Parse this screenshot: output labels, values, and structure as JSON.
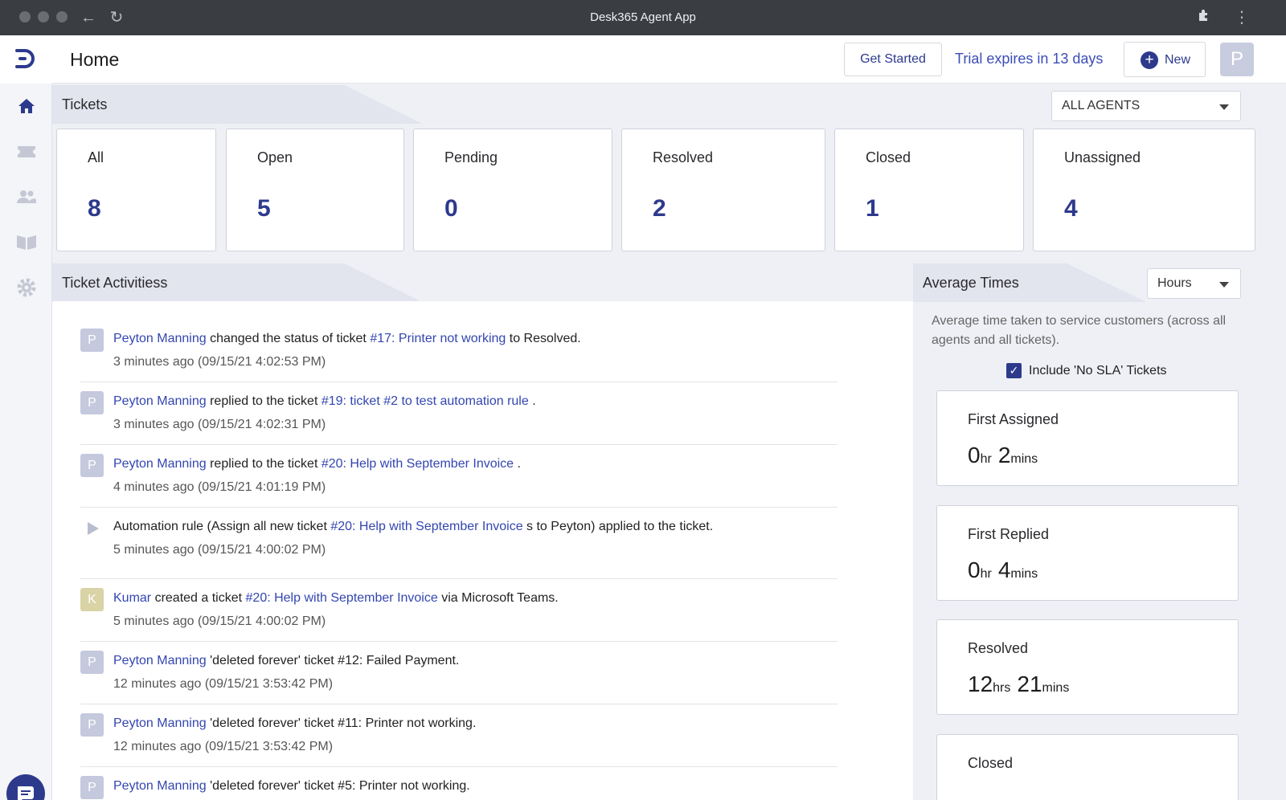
{
  "window": {
    "title": "Desk365 Agent App"
  },
  "header": {
    "title": "Home",
    "get_started": "Get Started",
    "trial": "Trial expires in 13 days",
    "new_label": "New",
    "avatar_initial": "P"
  },
  "nav": {
    "items": [
      {
        "icon": "home-icon"
      },
      {
        "icon": "tickets-icon"
      },
      {
        "icon": "contacts-icon"
      },
      {
        "icon": "knowledge-base-icon"
      },
      {
        "icon": "settings-icon"
      }
    ]
  },
  "tickets": {
    "section_title": "Tickets",
    "agent_filter": "ALL AGENTS",
    "stats": [
      {
        "label": "All",
        "value": "8"
      },
      {
        "label": "Open",
        "value": "5"
      },
      {
        "label": "Pending",
        "value": "0"
      },
      {
        "label": "Resolved",
        "value": "2"
      },
      {
        "label": "Closed",
        "value": "1"
      },
      {
        "label": "Unassigned",
        "value": "4"
      }
    ]
  },
  "activities": {
    "section_title": "Ticket Activitiess",
    "items": [
      {
        "avatar": "P",
        "actor": "Peyton Manning",
        "text1": " changed the status of ticket ",
        "link": "#17: Printer not working",
        "text2": " to Resolved.",
        "time": "3 minutes ago (09/15/21 4:02:53 PM)"
      },
      {
        "avatar": "P",
        "actor": "Peyton Manning",
        "text1": " replied to the ticket ",
        "link": "#19: ticket #2 to test automation rule",
        "text2": " .",
        "time": "3 minutes ago (09/15/21 4:02:31 PM)"
      },
      {
        "avatar": "P",
        "actor": "Peyton Manning",
        "text1": " replied to the ticket ",
        "link": "#20: Help with September Invoice",
        "text2": " .",
        "time": "4 minutes ago (09/15/21 4:01:19 PM)"
      },
      {
        "avatar": "",
        "actor": "",
        "text1": "Automation rule (Assign all new ticket ",
        "link": "#20: Help with September Invoice",
        "text2": " s to Peyton) applied to the ticket.",
        "time": "5 minutes ago (09/15/21 4:00:02 PM)"
      },
      {
        "avatar": "K",
        "actor": "Kumar",
        "text1": " created a ticket ",
        "link": "#20: Help with September Invoice",
        "text2": " via Microsoft Teams.",
        "time": "5 minutes ago (09/15/21 4:00:02 PM)"
      },
      {
        "avatar": "P",
        "actor": "Peyton Manning",
        "text1": " 'deleted forever' ticket #12: Failed Payment.",
        "link": "",
        "text2": "",
        "time": "12 minutes ago (09/15/21 3:53:42 PM)"
      },
      {
        "avatar": "P",
        "actor": "Peyton Manning",
        "text1": " 'deleted forever' ticket #11: Printer not working.",
        "link": "",
        "text2": "",
        "time": "12 minutes ago (09/15/21 3:53:42 PM)"
      },
      {
        "avatar": "P",
        "actor": "Peyton Manning",
        "text1": " 'deleted forever' ticket #5: Printer not working.",
        "link": "",
        "text2": "",
        "time": ""
      }
    ]
  },
  "average_times": {
    "section_title": "Average Times",
    "unit_filter": "Hours",
    "description": "Average time taken to service customers (across all agents and all tickets).",
    "include_no_sla_label": "Include 'No SLA' Tickets",
    "include_no_sla_checked": true,
    "cards": [
      {
        "label": "First Assigned",
        "v1": "0",
        "u1": "hr",
        "v2": "2",
        "u2": "mins"
      },
      {
        "label": "First Replied",
        "v1": "0",
        "u1": "hr",
        "v2": "4",
        "u2": "mins"
      },
      {
        "label": "Resolved",
        "v1": "12",
        "u1": "hrs",
        "v2": "21",
        "u2": "mins"
      },
      {
        "label": "Closed",
        "v1": "",
        "u1": "",
        "v2": "",
        "u2": ""
      }
    ]
  },
  "colors": {
    "accent": "#2d3a8c",
    "link": "#3346b0",
    "titlebar": "#3a3d42"
  }
}
